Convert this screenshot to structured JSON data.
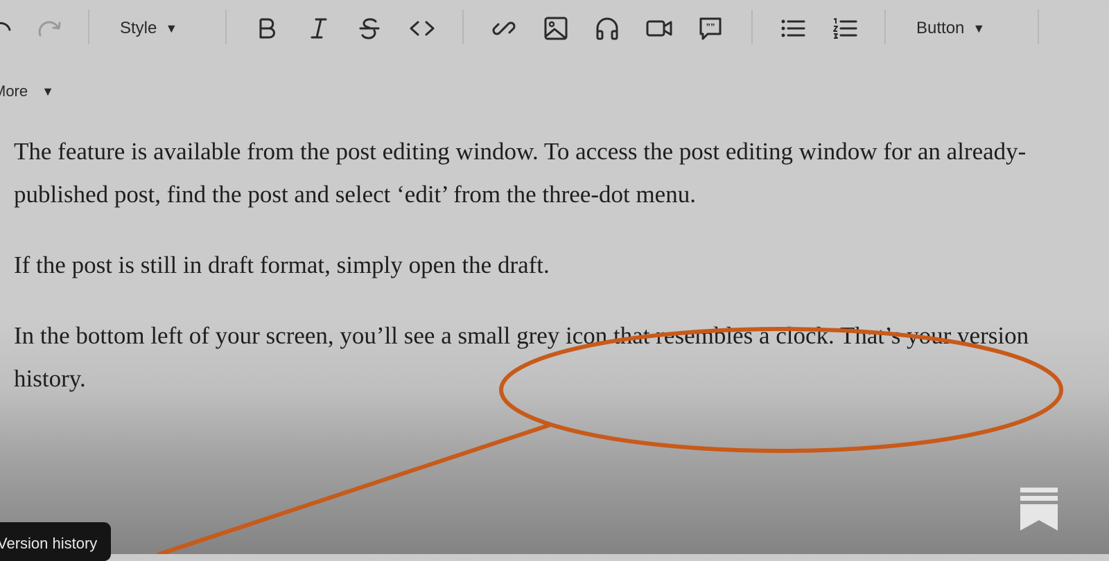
{
  "toolbar": {
    "style_label": "Style",
    "button_label": "Button",
    "more_label": "More"
  },
  "content": {
    "paragraphs": [
      "The feature is available from the post editing window.  To access the post editing window for an already-published post, find the post and select ‘edit’ from the three-dot menu.",
      "If the post is still in draft format, simply open the draft.",
      "In the bottom left of your screen, you’ll see a small grey icon that resembles a clock. That’s your version history."
    ]
  },
  "tooltip": {
    "text": "Version history"
  },
  "colors": {
    "background": "#cbcbcb",
    "annotation": "#c85a1a",
    "tooltip_bg": "#151515",
    "icon": "#2a2a2a"
  }
}
